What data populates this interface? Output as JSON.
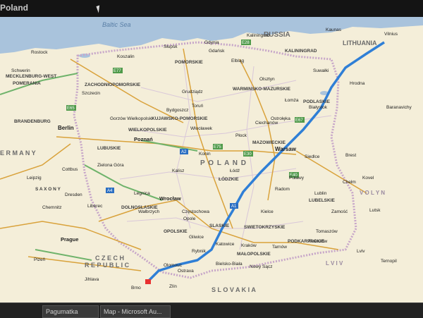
{
  "window": {
    "title": "Poland"
  },
  "taskbar": {
    "items": [
      "Pagumatka",
      "Map - Microsoft Au..."
    ]
  },
  "map": {
    "sea": "Baltic Sea",
    "countries": [
      {
        "key": "russia",
        "text": "RUSSIA"
      },
      {
        "key": "lithuania",
        "text": "LITHUANIA"
      },
      {
        "key": "poland",
        "text": "P O L A N D"
      },
      {
        "key": "germany",
        "text": "E R M A N Y"
      },
      {
        "key": "czech",
        "text": "C Z E C H"
      },
      {
        "key": "republic",
        "text": "R E P U B L I C"
      },
      {
        "key": "slovakia",
        "text": "S L O V A K I A"
      },
      {
        "key": "volyn",
        "text": "V O L Y N"
      },
      {
        "key": "lviv_region",
        "text": "L V I V"
      }
    ],
    "regions": [
      {
        "key": "pomorskie",
        "text": "POMORSKIE"
      },
      {
        "key": "zachodnio",
        "text": "ZACHODNIOPOMORSKIE"
      },
      {
        "key": "warminsko",
        "text": "WARMINSKO-MAZURSKIE"
      },
      {
        "key": "kujawsko",
        "text": "KUJAWSKO-POMORSKIE"
      },
      {
        "key": "wielkopolskie",
        "text": "WIELKOPOLSKIE"
      },
      {
        "key": "lubuskie",
        "text": "LUBUSKIE"
      },
      {
        "key": "podlaskie",
        "text": "PODLASKIE"
      },
      {
        "key": "mazowieckie",
        "text": "MAZOWIECKIE"
      },
      {
        "key": "lodzkie",
        "text": "ŁÓDZKIE"
      },
      {
        "key": "dolnoslaskie",
        "text": "DOLNOSLASKIE"
      },
      {
        "key": "opolskie",
        "text": "OPOLSKIE"
      },
      {
        "key": "slaskie",
        "text": "SLASKIE"
      },
      {
        "key": "swietokrzyskie",
        "text": "SWIETOKRZYSKIE"
      },
      {
        "key": "lubelskie",
        "text": "LUBELSKIE"
      },
      {
        "key": "malopolskie",
        "text": "MAŁOPOLSKIE"
      },
      {
        "key": "podkarpackie",
        "text": "PODKARPACKIE"
      },
      {
        "key": "mecklenburg",
        "text": "MECKLENBURG-WEST"
      },
      {
        "key": "pomerania",
        "text": "POMERANIA"
      },
      {
        "key": "brandenburg",
        "text": "BRANDENBURG"
      },
      {
        "key": "saxony",
        "text": "S A X O N Y"
      },
      {
        "key": "kaliningrad_reg",
        "text": "KALININGRAD"
      }
    ],
    "cities": [
      {
        "key": "gdansk",
        "text": "Gdańsk"
      },
      {
        "key": "gdynia",
        "text": "Gdynia"
      },
      {
        "key": "slupsk",
        "text": "Słupsk"
      },
      {
        "key": "koszalin",
        "text": "Koszalin"
      },
      {
        "key": "kaliningrad",
        "text": "Kaliningrad"
      },
      {
        "key": "kaunas",
        "text": "Kaunas"
      },
      {
        "key": "vilnius",
        "text": "Vilnius"
      },
      {
        "key": "elblag",
        "text": "Elbląg"
      },
      {
        "key": "olsztyn",
        "text": "Olsztyn"
      },
      {
        "key": "grudziadz",
        "text": "Grudziądz"
      },
      {
        "key": "bydgoszcz",
        "text": "Bydgoszcz"
      },
      {
        "key": "torun",
        "text": "Toruń"
      },
      {
        "key": "wloclawek",
        "text": "Włocławek"
      },
      {
        "key": "plock",
        "text": "Płock"
      },
      {
        "key": "bialystok",
        "text": "Białystok"
      },
      {
        "key": "warsaw",
        "text": "Warsaw"
      },
      {
        "key": "poznan",
        "text": "Poznań"
      },
      {
        "key": "berlin",
        "text": "Berlin"
      },
      {
        "key": "rostock",
        "text": "Rostock"
      },
      {
        "key": "schwerin",
        "text": "Schwerin"
      },
      {
        "key": "lodz",
        "text": "Łódź"
      },
      {
        "key": "radom",
        "text": "Radom"
      },
      {
        "key": "lublin",
        "text": "Lublin"
      },
      {
        "key": "kielce",
        "text": "Kielce"
      },
      {
        "key": "wroclaw",
        "text": "Wrocław"
      },
      {
        "key": "opole",
        "text": "Opole"
      },
      {
        "key": "czestochowa",
        "text": "Częstochowa"
      },
      {
        "key": "katowice",
        "text": "Katowice"
      },
      {
        "key": "krakow",
        "text": "Kraków"
      },
      {
        "key": "tarnow",
        "text": "Tarnów"
      },
      {
        "key": "rzeszow",
        "text": "Rzeszów"
      },
      {
        "key": "lviv",
        "text": "Lviv"
      },
      {
        "key": "prague",
        "text": "Prague"
      },
      {
        "key": "brno",
        "text": "Brno"
      },
      {
        "key": "ostrava",
        "text": "Ostrava"
      },
      {
        "key": "olomouc",
        "text": "Olomouc"
      },
      {
        "key": "dresden",
        "text": "Dresden"
      },
      {
        "key": "leipzig",
        "text": "Leipzig"
      },
      {
        "key": "chemnitz",
        "text": "Chemnitz"
      },
      {
        "key": "cottbus",
        "text": "Cottbus"
      },
      {
        "key": "zielona_gora",
        "text": "Zielona Góra"
      },
      {
        "key": "gorzow",
        "text": "Gorzów Wielkopolski"
      },
      {
        "key": "szczecin",
        "text": "Szczecin"
      },
      {
        "key": "legnica",
        "text": "Legnica"
      },
      {
        "key": "walbrzych",
        "text": "Wałbrzych"
      },
      {
        "key": "kalisz",
        "text": "Kalisz"
      },
      {
        "key": "konin",
        "text": "Konin"
      },
      {
        "key": "siedlce",
        "text": "Siedlce"
      },
      {
        "key": "brest",
        "text": "Brest"
      },
      {
        "key": "hrodna",
        "text": "Hrodna"
      },
      {
        "key": "ostroleka",
        "text": "Ostrołęka"
      },
      {
        "key": "suwalki",
        "text": "Suwałki"
      },
      {
        "key": "lomza",
        "text": "Łomża"
      },
      {
        "key": "gliwice",
        "text": "Gliwice"
      },
      {
        "key": "bielsko",
        "text": "Bielsko-Biała"
      },
      {
        "key": "rybnik",
        "text": "Rybnik"
      },
      {
        "key": "nowy_sacz",
        "text": "Nowy Sącz"
      },
      {
        "key": "tomaszow",
        "text": "Tomaszów"
      },
      {
        "key": "zamosc",
        "text": "Zamość"
      },
      {
        "key": "lutsk",
        "text": "Lutsk"
      },
      {
        "key": "ternopil",
        "text": "Ternopil"
      },
      {
        "key": "pulawy",
        "text": "Puławy"
      },
      {
        "key": "ciechanow",
        "text": "Ciechanów"
      },
      {
        "key": "chelm",
        "text": "Chełm"
      },
      {
        "key": "kovel",
        "text": "Kovel"
      },
      {
        "key": "baranavichy",
        "text": "Baranavichy"
      },
      {
        "key": "jihlava",
        "text": "Jihlava"
      },
      {
        "key": "zlin",
        "text": "Zlín"
      },
      {
        "key": "plzen",
        "text": "Plzeň"
      },
      {
        "key": "liberec",
        "text": "Liberec"
      }
    ],
    "road_shields": [
      "E28",
      "E77",
      "E30",
      "E67",
      "E40",
      "A2",
      "A4",
      "E75",
      "A1",
      "E65"
    ],
    "colors": {
      "land": "#f4eed9",
      "sea": "#a9c3dc",
      "route": "#2f7fd6",
      "border": "#c7a6c9",
      "road_major": "#d9a23b",
      "road_green": "#6fb36b"
    }
  }
}
